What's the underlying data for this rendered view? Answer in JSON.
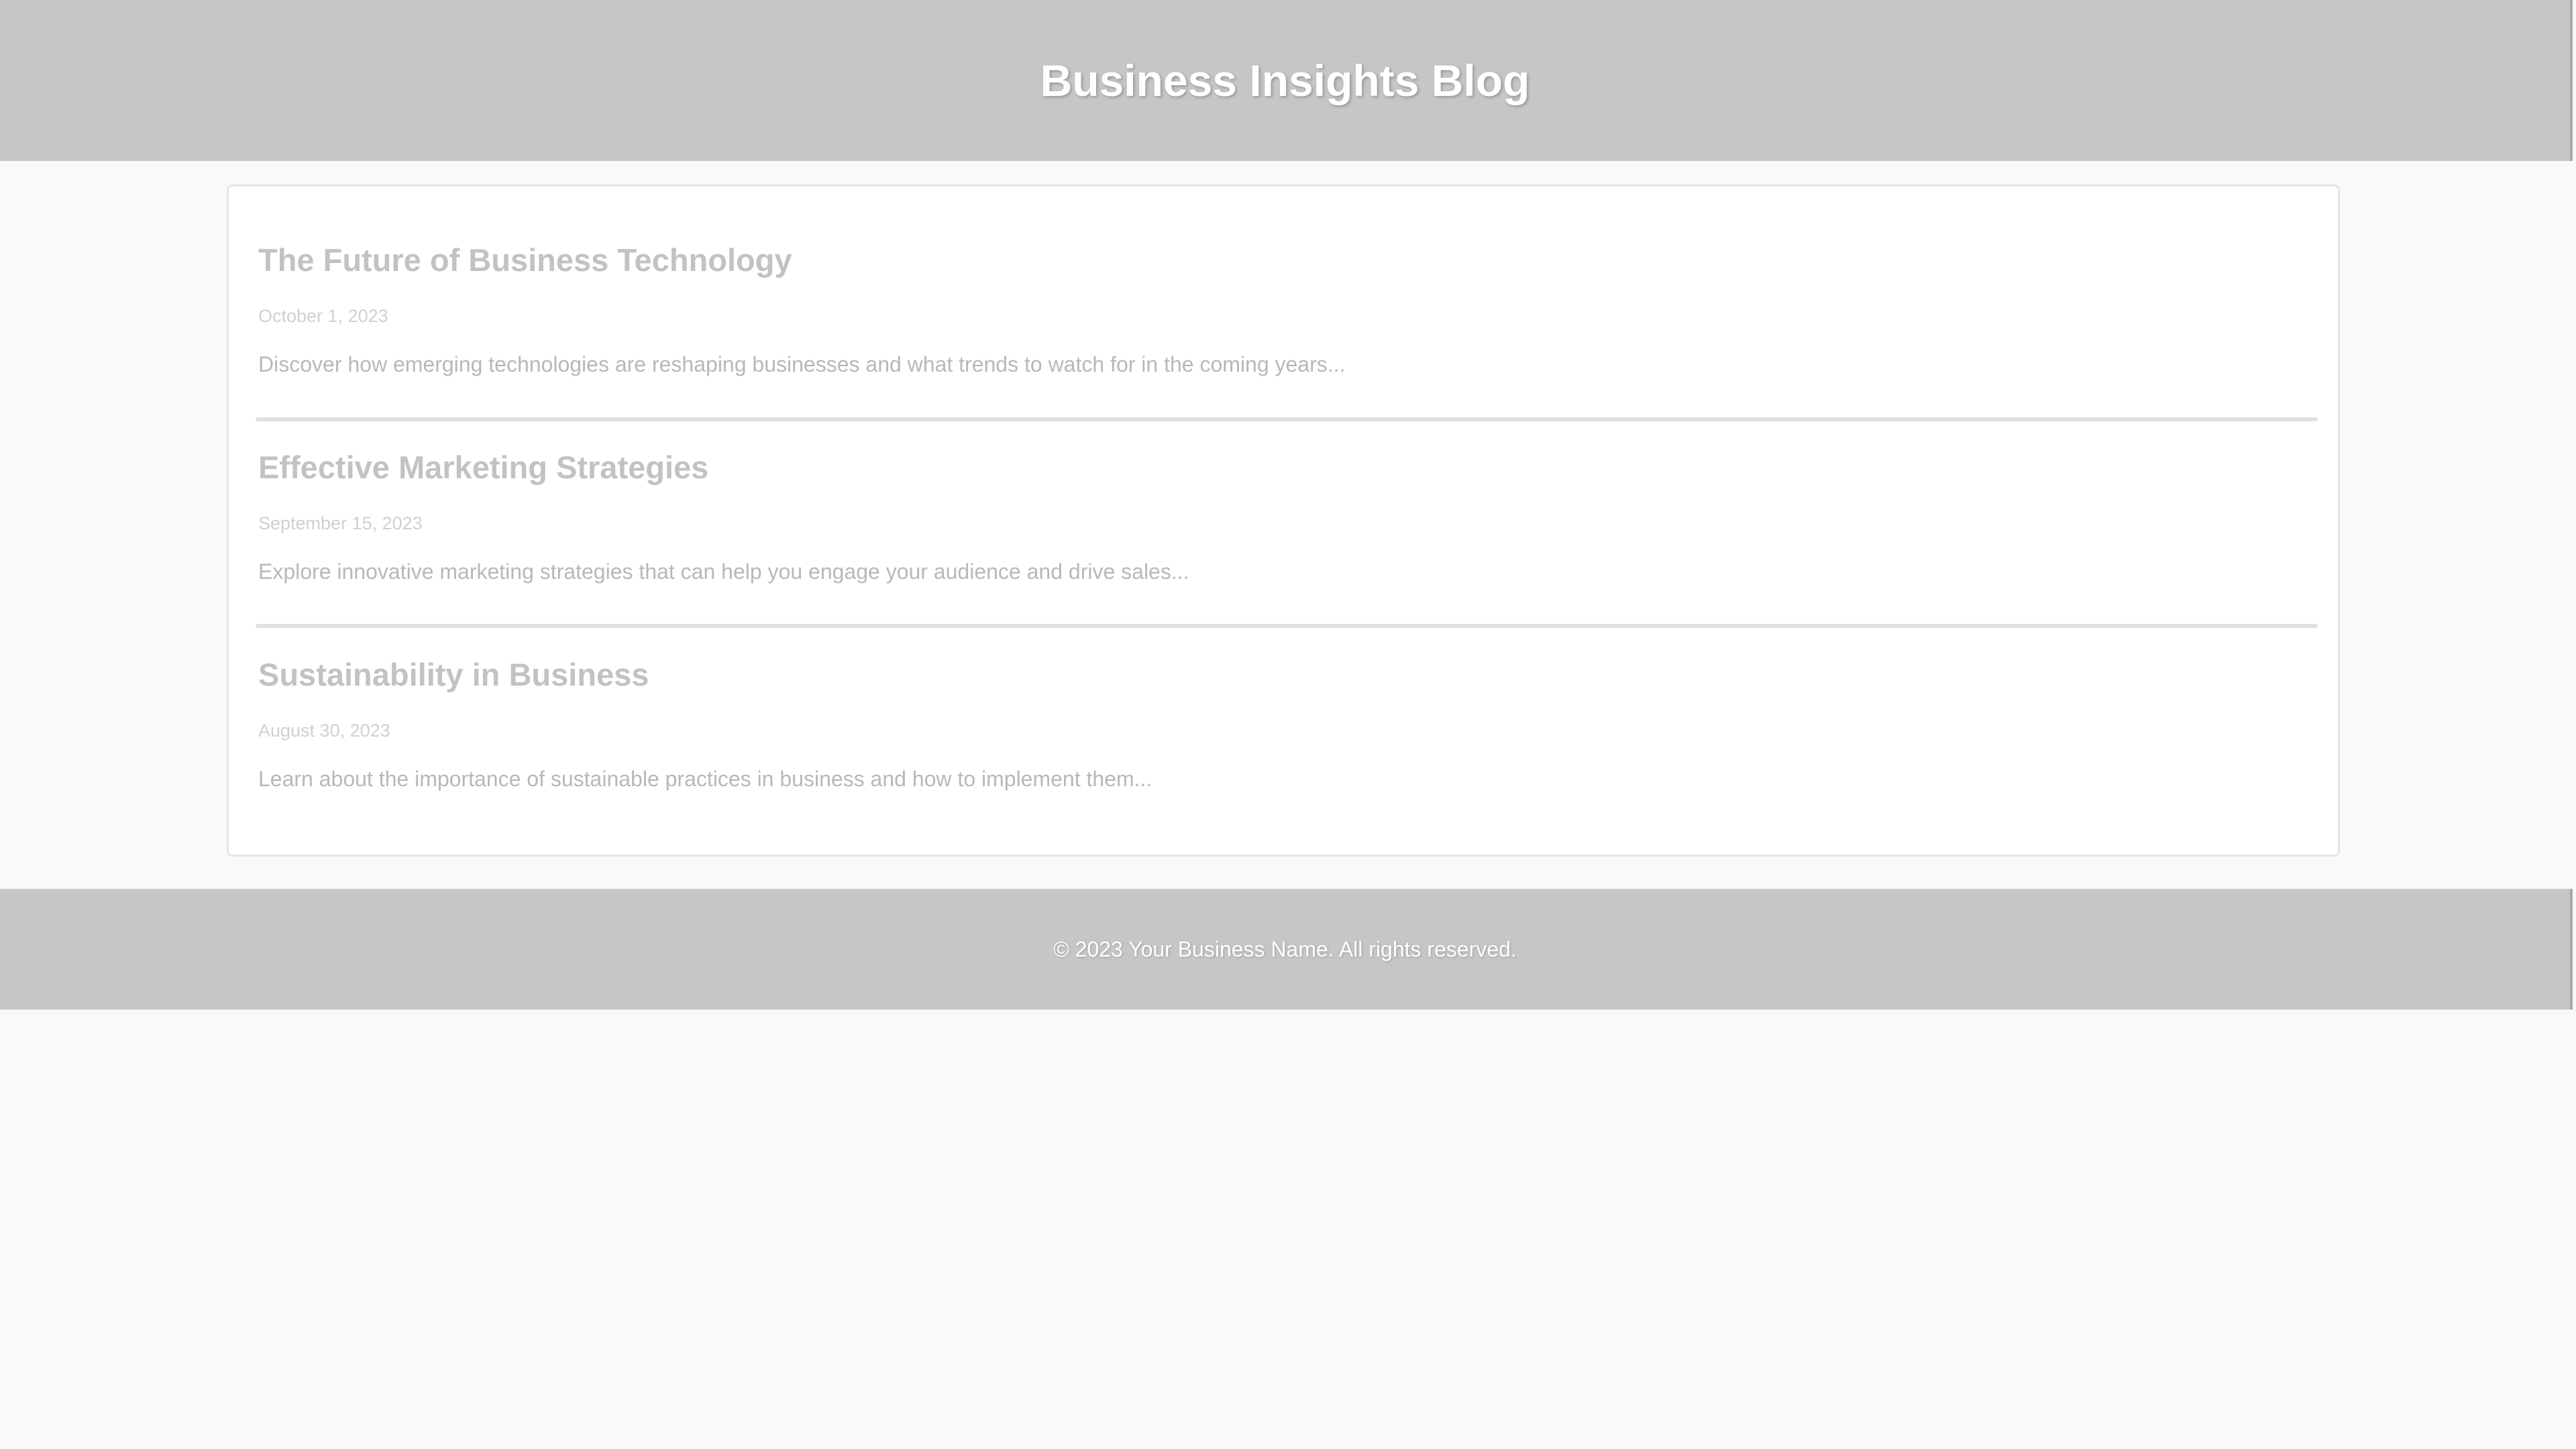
{
  "header": {
    "title": "Business Insights Blog"
  },
  "posts": [
    {
      "title": "The Future of Business Technology",
      "date": "October 1, 2023",
      "excerpt": "Discover how emerging technologies are reshaping businesses and what trends to watch for in the coming years..."
    },
    {
      "title": "Effective Marketing Strategies",
      "date": "September 15, 2023",
      "excerpt": "Explore innovative marketing strategies that can help you engage your audience and drive sales..."
    },
    {
      "title": "Sustainability in Business",
      "date": "August 30, 2023",
      "excerpt": "Learn about the importance of sustainable practices in business and how to implement them..."
    }
  ],
  "footer": {
    "text": "© 2023 Your Business Name. All rights reserved."
  },
  "colors": {
    "header_bg": "#c6c6c6",
    "page_bg": "#f9f9f9",
    "card_bg": "#ffffff"
  }
}
